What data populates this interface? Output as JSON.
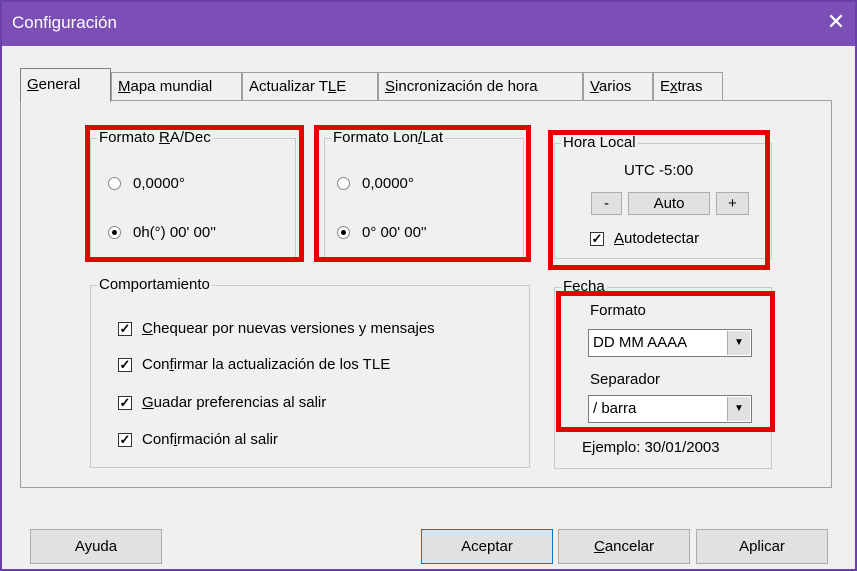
{
  "window": {
    "title": "Configuración"
  },
  "tabs": [
    {
      "pre": "",
      "ul": "G",
      "post": "eneral"
    },
    {
      "pre": "",
      "ul": "M",
      "post": "apa mundial"
    },
    {
      "pre": "Actualizar T",
      "ul": "L",
      "post": "E"
    },
    {
      "pre": "",
      "ul": "S",
      "post": "incronización de hora"
    },
    {
      "pre": "",
      "ul": "V",
      "post": "arios"
    },
    {
      "pre": "E",
      "ul": "x",
      "post": "tras"
    }
  ],
  "radec": {
    "legend_pre": "Formato ",
    "legend_ul": "R",
    "legend_post": "A/Dec",
    "option1": "0,0000°",
    "option2": "0h(°) 00' 00''"
  },
  "lonlat": {
    "legend_pre": "Formato Lon",
    "legend_ul": "/",
    "legend_post": "Lat",
    "option1": "0,0000°",
    "option2": "0° 00' 00''"
  },
  "hora": {
    "legend": "Hora Local",
    "utc": "UTC -5:00",
    "minus": "-",
    "auto": "Auto",
    "plus": "+",
    "auto_pre": "",
    "auto_ul": "A",
    "auto_post": "utodetectar"
  },
  "comportamiento": {
    "legend": "Comportamiento",
    "items": [
      {
        "pre": "",
        "ul": "C",
        "post": "hequear por nuevas versiones y mensajes"
      },
      {
        "pre": "Con",
        "ul": "f",
        "post": "irmar la actualización de los TLE"
      },
      {
        "pre": "",
        "ul": "G",
        "post": "uadar preferencias al salir"
      },
      {
        "pre": "Conf",
        "ul": "i",
        "post": "rmación al salir"
      }
    ]
  },
  "fecha": {
    "legend": "Fecha",
    "formato_label": "Formato",
    "formato_value": "DD MM AAAA",
    "separador_label": "Separador",
    "separador_value": "/ barra",
    "ejemplo": "Ejemplo: 30/01/2003"
  },
  "buttons": {
    "ayuda": "Ayuda",
    "aceptar": "Aceptar",
    "cancelar_ul": "C",
    "cancelar_post": "ancelar",
    "aplicar": "Aplicar"
  }
}
